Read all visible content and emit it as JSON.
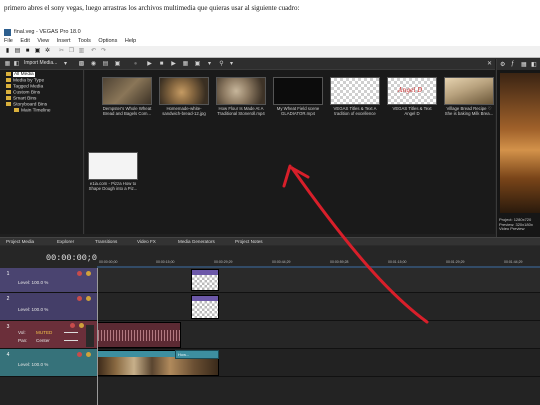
{
  "caption": "primero abres el sony vegas, luego arrastras los archivos multimedia que quieras usar al siguiente cuadro:",
  "window": {
    "title": "final.veg - VEGAS Pro 18.0"
  },
  "menu": [
    "File",
    "Edit",
    "View",
    "Insert",
    "Tools",
    "Options",
    "Help"
  ],
  "media_panel": {
    "import_label": "Import Media...",
    "tree": [
      {
        "label": "All Media",
        "selected": true
      },
      {
        "label": "Media by Type",
        "selected": false
      },
      {
        "label": "Tagged Media",
        "selected": false
      },
      {
        "label": "Custom Bins",
        "selected": false
      },
      {
        "label": "Smart Bins",
        "selected": false
      },
      {
        "label": "Storyboard Bins",
        "selected": false
      },
      {
        "label": "Main Timeline",
        "selected": false
      }
    ],
    "thumbnails": [
      {
        "caption": "Dempster's Whole Wheat Bread and Bagels Com...",
        "color": "#6b5a44"
      },
      {
        "caption": "Homemade-white-sandwich-bread-12.jpg",
        "color": "#9a7f5a"
      },
      {
        "caption": "How Flour Is Made At A Traditional Stoneroll.mp4",
        "color": "#8d7a62"
      },
      {
        "caption": "My Wheat Field scene GLADIATOR.mp4",
        "color": "#0c0c0c"
      },
      {
        "caption": "VEGAS Titles & Text A tradition of excellence",
        "color": "#c9c9c9"
      },
      {
        "caption": "VEGAS Titles & Text Angel D",
        "color": "#c9c9c9"
      },
      {
        "caption": "Village Bread Recipe ♡ She is baking Milk Brea...",
        "color": "#b8a27e"
      },
      {
        "caption": "e1ia.com - Pizza How to Shape Dough into a Piz...",
        "color": "#f4f4f4"
      }
    ],
    "overlay_texts": [
      "",
      "Angel D"
    ]
  },
  "preview": {
    "project_line": "Project:",
    "project_val": "1280x720",
    "preview_line": "Preview:",
    "preview_val": "320x180x",
    "video_preview_tab": "Video Preview"
  },
  "tabs": [
    "Project Media",
    "Explorer",
    "Transitions",
    "Video FX",
    "Media Generators",
    "Project Notes"
  ],
  "timeline": {
    "timecode": "00:00:00;00",
    "ruler_ticks": [
      "00:00:00;00",
      "00:00:15;00",
      "00:00:29;29",
      "00:00:44;29",
      "00:00:59;28",
      "00:01:15;00",
      "00:01:29;29",
      "00:01:44;29"
    ],
    "tracks": [
      {
        "num": "1",
        "level": "Level: 100.0 %"
      },
      {
        "num": "2",
        "level": "Level: 100.0 %"
      },
      {
        "num": "3",
        "vol": "Vol:",
        "vol_val": "MUTED",
        "pan": "Pan:",
        "pan_val": "Center"
      },
      {
        "num": "4",
        "level": "Level: 100.0 %"
      }
    ],
    "clip_label": "How..."
  },
  "accent": "#d81f2a"
}
